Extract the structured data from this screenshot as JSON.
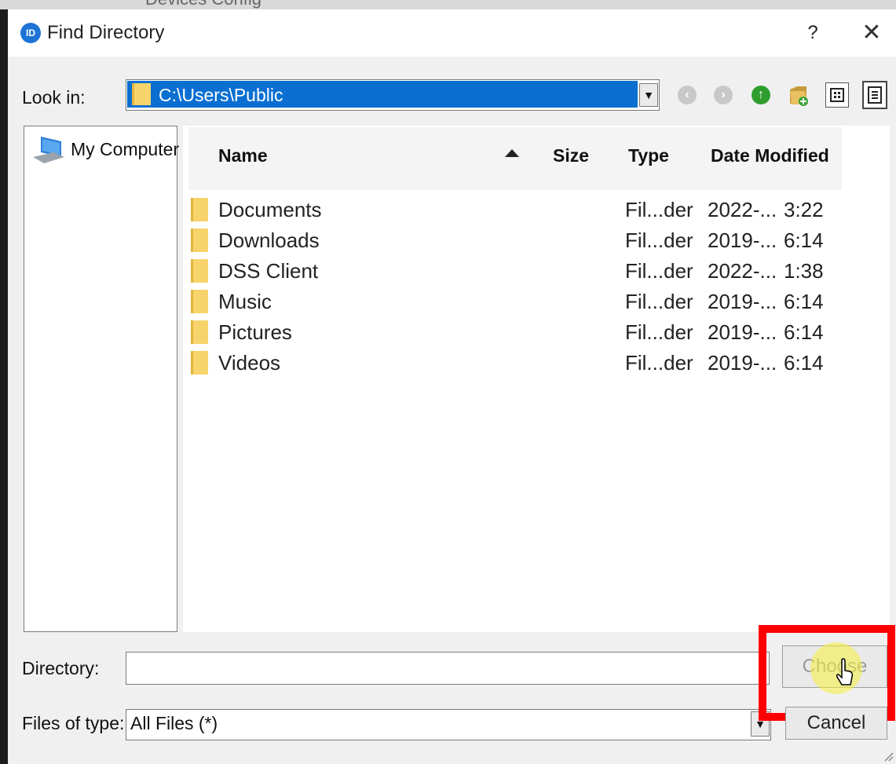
{
  "background_window": {
    "title_fragment": "Devices Config"
  },
  "dialog": {
    "title": "Find Directory",
    "app_icon_text": "ID",
    "help_label": "?",
    "close_label": "✕"
  },
  "look_in": {
    "label": "Look in:",
    "value": "C:\\Users\\Public"
  },
  "toolbar": {
    "icons": [
      "back-icon",
      "forward-icon",
      "up-folder-icon",
      "new-folder-icon",
      "list-view-icon",
      "details-view-icon"
    ]
  },
  "places": {
    "items": [
      {
        "label": "My Computer",
        "icon": "computer-icon"
      }
    ]
  },
  "file_list": {
    "columns": [
      "Name",
      "Size",
      "Type",
      "Date Modified"
    ],
    "sort_column": "Name",
    "sort_direction": "ascending",
    "rows": [
      {
        "name": "Documents",
        "size": "",
        "type": "Fil...der",
        "date": "2022-...",
        "time": "3:22"
      },
      {
        "name": "Downloads",
        "size": "",
        "type": "Fil...der",
        "date": "2019-...",
        "time": "6:14"
      },
      {
        "name": "DSS Client",
        "size": "",
        "type": "Fil...der",
        "date": "2022-...",
        "time": "1:38"
      },
      {
        "name": "Music",
        "size": "",
        "type": "Fil...der",
        "date": "2019-...",
        "time": "6:14"
      },
      {
        "name": "Pictures",
        "size": "",
        "type": "Fil...der",
        "date": "2019-...",
        "time": "6:14"
      },
      {
        "name": "Videos",
        "size": "",
        "type": "Fil...der",
        "date": "2019-...",
        "time": "6:14"
      }
    ]
  },
  "directory": {
    "label": "Directory:",
    "value": ""
  },
  "files_of_type": {
    "label": "Files of type:",
    "value": "All Files (*)"
  },
  "buttons": {
    "choose": "Choose",
    "cancel": "Cancel"
  },
  "colors": {
    "selection": "#0a6fd1",
    "highlight": "#ff0000",
    "folder": "#f7d46b",
    "cursor_glow": "#f5f03c"
  }
}
